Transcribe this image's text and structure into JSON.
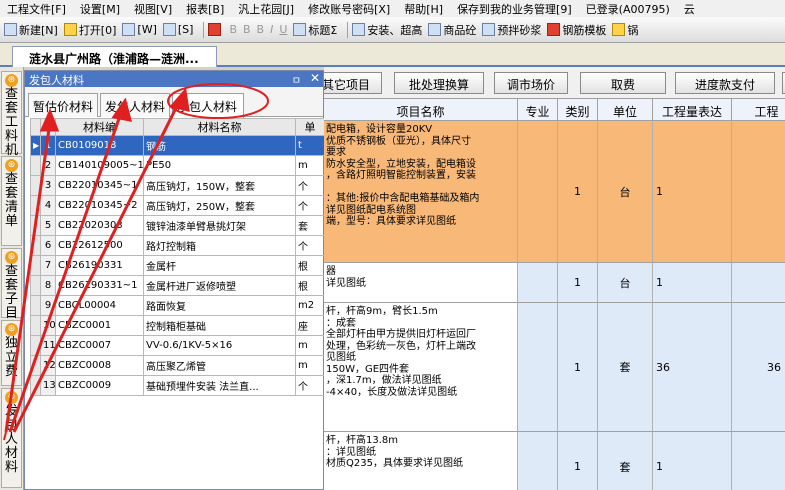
{
  "menu": [
    "工程文件[F]",
    "设置[M]",
    "视图[V]",
    "报表[B]",
    "汎上花园[J]",
    "修改账号密码[X]",
    "帮助[H]",
    "保存到我的业务管理[9]",
    "已登录(A00795)",
    "云"
  ],
  "toolbar": {
    "items": [
      "新建[N]",
      "打开[0]",
      "[W]",
      "[S]",
      "B",
      "B",
      "B",
      "I",
      "U",
      "标题Σ",
      "安装、超高",
      "商品砼",
      "预拌砂浆",
      "钢筋模板",
      "锅"
    ]
  },
  "doc_tab": "涟水县广州路（淮浦路—涟洲...",
  "sidebar": [
    {
      "label": "查套工料机"
    },
    {
      "label": "查套清单"
    },
    {
      "label": "查套子目"
    },
    {
      "label": "独立费"
    },
    {
      "label": "发包人材料"
    }
  ],
  "panel": {
    "title": "发包人材料",
    "pin": "ㅁ",
    "close": "✕",
    "tabs": [
      "暂估价材料",
      "发包人材料",
      "承包人材料"
    ],
    "columns": [
      "",
      "材料编",
      "材料名称",
      "单"
    ],
    "rows": [
      {
        "no": "1",
        "code": "CB0109018",
        "name": "钢筋",
        "unit": "t"
      },
      {
        "no": "2",
        "code": "CB140109005~1",
        "name": "PE50",
        "unit": "m"
      },
      {
        "no": "3",
        "code": "CB22010345~1",
        "name": "高压钠灯，150W，整套",
        "unit": "个"
      },
      {
        "no": "4",
        "code": "CB22010345~2",
        "name": "高压钠灯，250W，整套",
        "unit": "个"
      },
      {
        "no": "5",
        "code": "CB22020303",
        "name": "镀锌油漆单臂悬挑灯架",
        "unit": "套"
      },
      {
        "no": "6",
        "code": "CB22612500",
        "name": "路灯控制箱",
        "unit": "个"
      },
      {
        "no": "7",
        "code": "CB26190331",
        "name": "金属杆",
        "unit": "根"
      },
      {
        "no": "8",
        "code": "CB26190331~1",
        "name": "金属杆进厂返修喷塑",
        "unit": "根"
      },
      {
        "no": "9",
        "code": "CBCL00004",
        "name": "路面恢复",
        "unit": "m2"
      },
      {
        "no": "10",
        "code": "CBZC0001",
        "name": "控制箱柜基础",
        "unit": "座"
      },
      {
        "no": "11",
        "code": "CBZC0007",
        "name": "VV-0.6/1KV-5×16",
        "unit": "m"
      },
      {
        "no": "12",
        "code": "CBZC0008",
        "name": "高压聚乙烯管",
        "unit": "m"
      },
      {
        "no": "13",
        "code": "CBZC0009",
        "name": "基础预埋件安装 法兰直...",
        "unit": "个"
      }
    ]
  },
  "right": {
    "buttons": [
      "其它项目",
      "批处理换算",
      "调市场价",
      "取费",
      "进度款支付",
      "我"
    ],
    "headers": [
      "项目名称",
      "专业",
      "类别",
      "单位",
      "工程量表达",
      "工程"
    ],
    "rows": [
      {
        "desc": "配电箱，设计容量20KV\n优质不锈钢板（亚光），具体尺寸\n要求\n防水安全型，立地安装，配电箱设\n，含路灯照明智能控制装置，安装\n\n：其他:报价中含配电箱基础及箱内\n详见图纸配电系统图\n端，型号：具体要求详见图纸",
        "cat": "1",
        "unit": "台",
        "expr": "1",
        "qty": ""
      },
      {
        "desc": "器\n详见图纸",
        "cat": "1",
        "unit": "台",
        "expr": "1",
        "qty": ""
      },
      {
        "desc": "杆，杆高9m，臂长1.5m\n：成套\n全部灯杆由甲方提供旧灯杆运回厂\n处理，色彩统一灰色，灯杆上端改\n见图纸\n150W，GE四件套\n，深1.7m，做法详见图纸\n-4×40，长度及做法详见图纸",
        "cat": "1",
        "unit": "套",
        "expr": "36",
        "qty": "36"
      },
      {
        "desc": "杆，杆高13.8m\n：详见图纸\n材质Q235，具体要求详见图纸",
        "cat": "1",
        "unit": "套",
        "expr": "1",
        "qty": ""
      }
    ]
  }
}
